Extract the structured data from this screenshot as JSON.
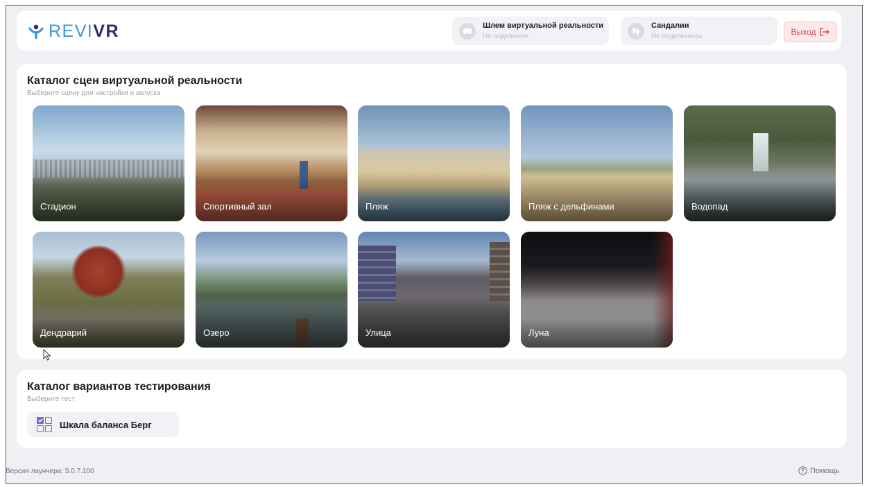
{
  "app": {
    "logo_light": "REVI",
    "logo_bold": "VR",
    "brand_colors": {
      "light": "#3c96d6",
      "dark": "#2c2c6e"
    }
  },
  "header": {
    "devices": [
      {
        "name": "Шлем виртуальной реальности",
        "status": "Не подключен",
        "icon": "vr-headset-icon"
      },
      {
        "name": "Сандалии",
        "status": "Не подключены",
        "icon": "footprints-icon"
      }
    ],
    "exit_label": "Выход",
    "exit_icon": "logout-arrow-icon",
    "exit_color": "#e0465f"
  },
  "scenes_panel": {
    "title": "Каталог сцен виртуальной реальности",
    "subtitle": "Выберите сцену для настройки и запуска",
    "scenes": [
      {
        "label": "Стадион"
      },
      {
        "label": "Спортивный зал"
      },
      {
        "label": "Пляж"
      },
      {
        "label": "Пляж с дельфинами"
      },
      {
        "label": "Водопад"
      },
      {
        "label": "Дендрарий"
      },
      {
        "label": "Озеро"
      },
      {
        "label": "Улица"
      },
      {
        "label": "Луна"
      }
    ]
  },
  "tests_panel": {
    "title": "Каталог вариантов тестирования",
    "subtitle": "Выберите тест",
    "tests": [
      {
        "label": "Шкала баланса Берг",
        "icon": "checklist-grid-icon"
      }
    ]
  },
  "footer": {
    "version": "Версия лаунчера: 5.0.7.100",
    "help_label": "Помощь",
    "help_icon": "help-circle-icon"
  }
}
